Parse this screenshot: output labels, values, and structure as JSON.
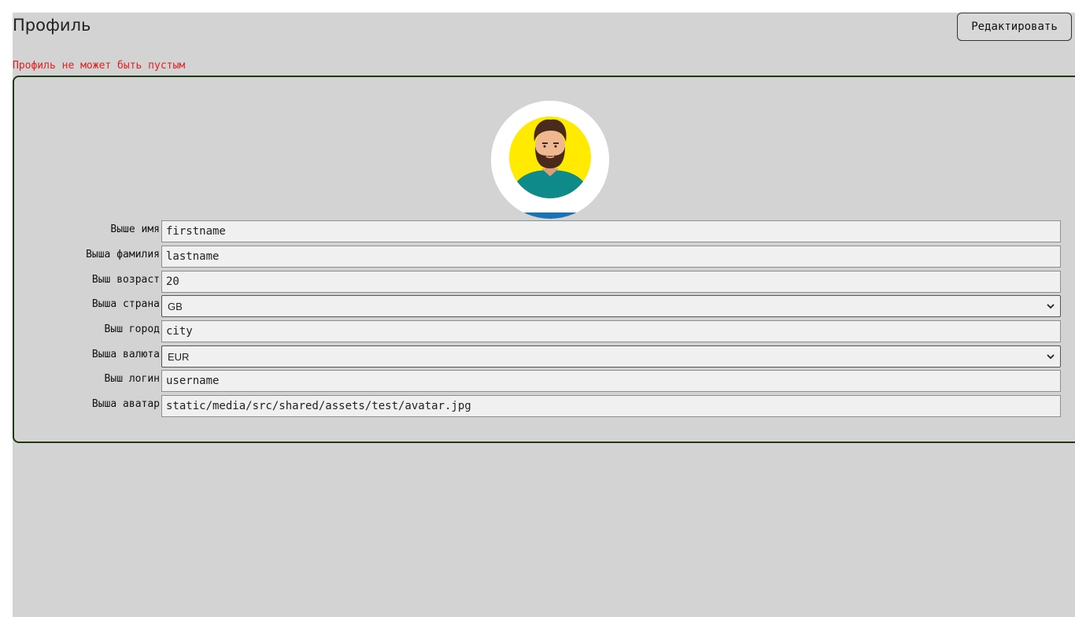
{
  "header": {
    "title": "Профиль",
    "edit_label": "Редактировать"
  },
  "error": "Профиль не может быть пустым",
  "form": {
    "firstname": {
      "label": "Выше имя",
      "value": "firstname"
    },
    "lastname": {
      "label": "Выша фамилия",
      "value": "lastname"
    },
    "age": {
      "label": "Выш возраст",
      "value": "20"
    },
    "country": {
      "label": "Выша страна",
      "value": "GB"
    },
    "city": {
      "label": "Выш город",
      "value": "city"
    },
    "currency": {
      "label": "Выша валюта",
      "value": "EUR"
    },
    "username": {
      "label": "Выш логин",
      "value": "username"
    },
    "avatar": {
      "label": "Выша аватар",
      "value": "static/media/src/shared/assets/test/avatar.jpg"
    }
  },
  "icons": {
    "avatar": "avatar-image",
    "select_arrow": "chevron-down-icon"
  },
  "colors": {
    "background": "#d3d3d3",
    "error": "#e02020",
    "card_border": "#1f3a12",
    "field_bg": "#f0f0f0",
    "avatar_circle": "#ffea00",
    "avatar_shirt": "#0e8a8a"
  }
}
